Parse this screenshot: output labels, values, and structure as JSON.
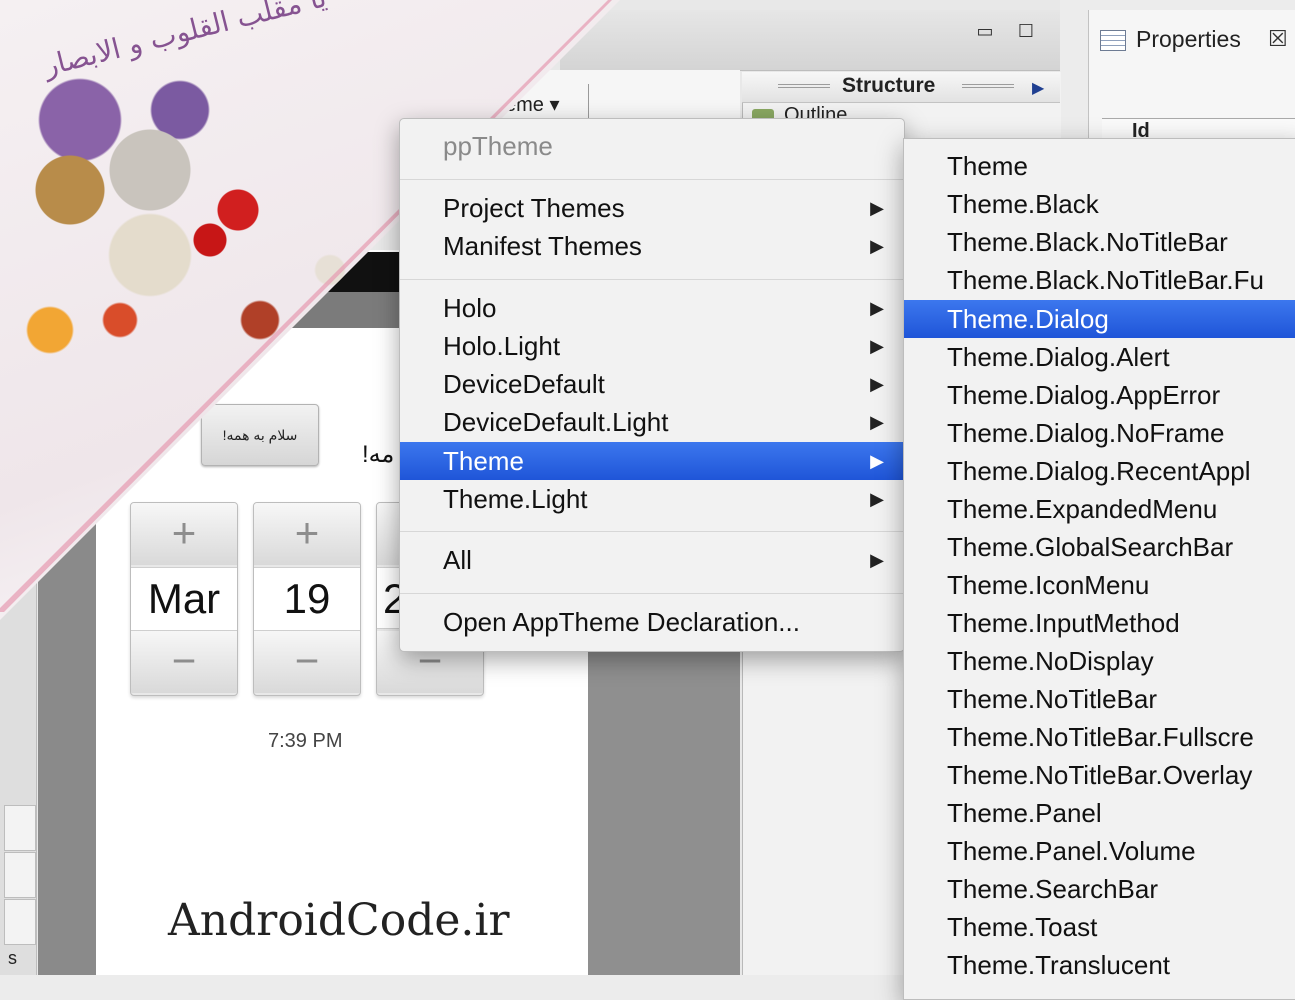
{
  "window": {
    "minimize_glyph": "▭",
    "maximize_glyph": "☐"
  },
  "toolbar": {
    "theme_dropdown": "eme ▾"
  },
  "structure": {
    "title": "Structure",
    "outline": "Outline"
  },
  "properties": {
    "title": "Properties",
    "close": "☒",
    "column_id": "Id"
  },
  "phone": {
    "hello_button": "سلام به همه!",
    "hello_text": "مه!",
    "pickers": [
      {
        "plus": "+",
        "value": "Mar",
        "minus": "−"
      },
      {
        "plus": "+",
        "value": "19",
        "minus": "−"
      },
      {
        "plus": "+",
        "value": "2",
        "minus": "−"
      }
    ],
    "time": "7:39 PM",
    "brand": "AndroidCode.ir",
    "side_label": "s",
    "calligraphy": "یا مقلب القلوب و الابصار"
  },
  "menu": {
    "header": "ppTheme",
    "items": [
      {
        "label": "Project Themes",
        "submenu": true
      },
      {
        "label": "Manifest Themes",
        "submenu": true
      },
      {
        "label": "Holo",
        "submenu": true
      },
      {
        "label": "Holo.Light",
        "submenu": true
      },
      {
        "label": "DeviceDefault",
        "submenu": true
      },
      {
        "label": "DeviceDefault.Light",
        "submenu": true
      },
      {
        "label": "Theme",
        "submenu": true,
        "highlighted": true
      },
      {
        "label": "Theme.Light",
        "submenu": true
      },
      {
        "label": "All",
        "submenu": true
      },
      {
        "label": "Open AppTheme Declaration...",
        "submenu": false
      }
    ],
    "arrow_glyph": "▶"
  },
  "submenu": {
    "items": [
      "Theme",
      "Theme.Black",
      "Theme.Black.NoTitleBar",
      "Theme.Black.NoTitleBar.Fu",
      "Theme.Dialog",
      "Theme.Dialog.Alert",
      "Theme.Dialog.AppError",
      "Theme.Dialog.NoFrame",
      "Theme.Dialog.RecentAppl",
      "Theme.ExpandedMenu",
      "Theme.GlobalSearchBar",
      "Theme.IconMenu",
      "Theme.InputMethod",
      "Theme.NoDisplay",
      "Theme.NoTitleBar",
      "Theme.NoTitleBar.Fullscre",
      "Theme.NoTitleBar.Overlay",
      "Theme.Panel",
      "Theme.Panel.Volume",
      "Theme.SearchBar",
      "Theme.Toast",
      "Theme.Translucent"
    ],
    "selected": "Theme.Dialog"
  },
  "colors": {
    "highlight": "#2a62e3",
    "menu_bg": "#f2f2f2"
  }
}
